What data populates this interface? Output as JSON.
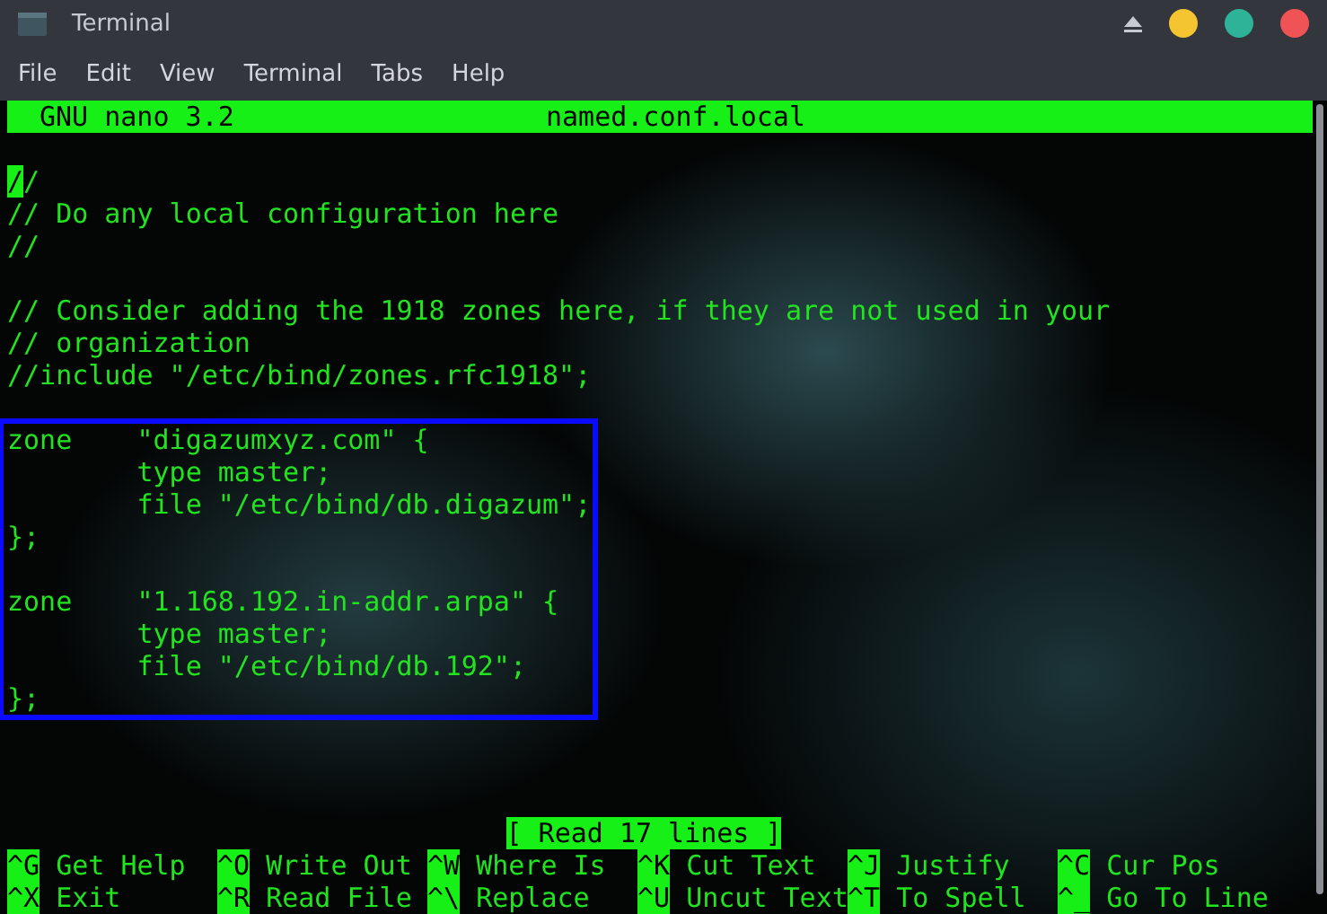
{
  "window": {
    "title": "Terminal"
  },
  "menu": [
    "File",
    "Edit",
    "View",
    "Terminal",
    "Tabs",
    "Help"
  ],
  "nano": {
    "version": "GNU nano 3.2",
    "filename": "named.conf.local"
  },
  "blocks": [
    {
      "highlighted": false,
      "cursor": true,
      "paragraphs": [
        [
          "//",
          "// Do any local configuration here",
          "//"
        ]
      ]
    },
    {
      "highlighted": false,
      "cursor": false,
      "paragraphs": [
        [
          "// Consider adding the 1918 zones here, if they are not used in your",
          "// organization",
          "//include \"/etc/bind/zones.rfc1918\";"
        ]
      ]
    },
    {
      "highlighted": true,
      "cursor": false,
      "paragraphs": [
        [
          "zone    \"digazumxyz.com\" {",
          "        type master;",
          "        file \"/etc/bind/db.digazum\";",
          "};"
        ],
        [
          "zone    \"1.168.192.in-addr.arpa\" {",
          "        type master;",
          "        file \"/etc/bind/db.192\";",
          "};"
        ]
      ]
    }
  ],
  "status": "[ Read 17 lines ]",
  "shortcuts": [
    {
      "key": "^G",
      "label": "Get Help"
    },
    {
      "key": "^O",
      "label": "Write Out"
    },
    {
      "key": "^W",
      "label": "Where Is"
    },
    {
      "key": "^K",
      "label": "Cut Text"
    },
    {
      "key": "^J",
      "label": "Justify"
    },
    {
      "key": "^C",
      "label": "Cur Pos"
    },
    {
      "key": "^X",
      "label": "Exit"
    },
    {
      "key": "^R",
      "label": "Read File"
    },
    {
      "key": "^\\",
      "label": "Replace"
    },
    {
      "key": "^U",
      "label": "Uncut Text"
    },
    {
      "key": "^T",
      "label": "To Spell"
    },
    {
      "key": "^_",
      "label": "Go To Line"
    }
  ]
}
